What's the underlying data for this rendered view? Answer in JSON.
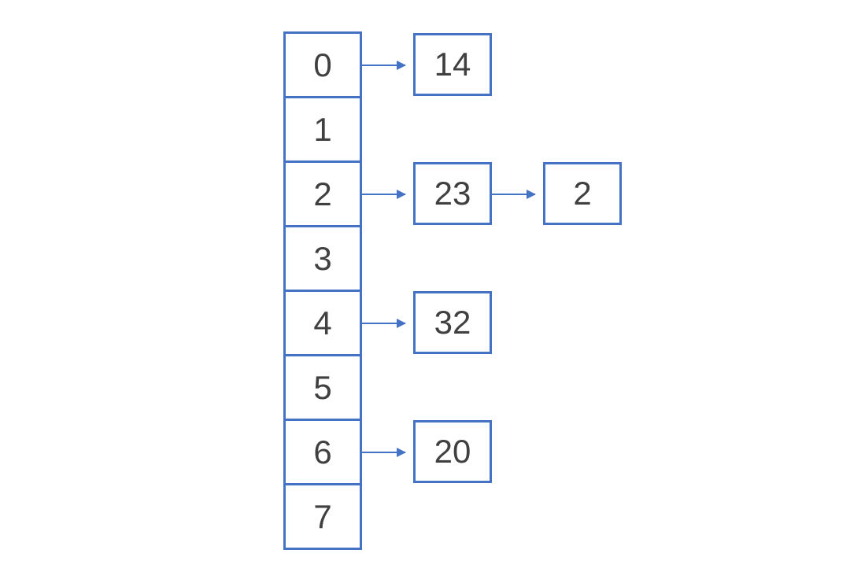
{
  "hash_table": {
    "indices": [
      "0",
      "1",
      "2",
      "3",
      "4",
      "5",
      "6",
      "7"
    ],
    "chains": [
      {
        "index": 0,
        "values": [
          "14"
        ]
      },
      {
        "index": 2,
        "values": [
          "23",
          "2"
        ]
      },
      {
        "index": 4,
        "values": [
          "32"
        ]
      },
      {
        "index": 6,
        "values": [
          "20"
        ]
      }
    ]
  },
  "style": {
    "border_color": "#4472c4",
    "text_color": "#404040"
  }
}
